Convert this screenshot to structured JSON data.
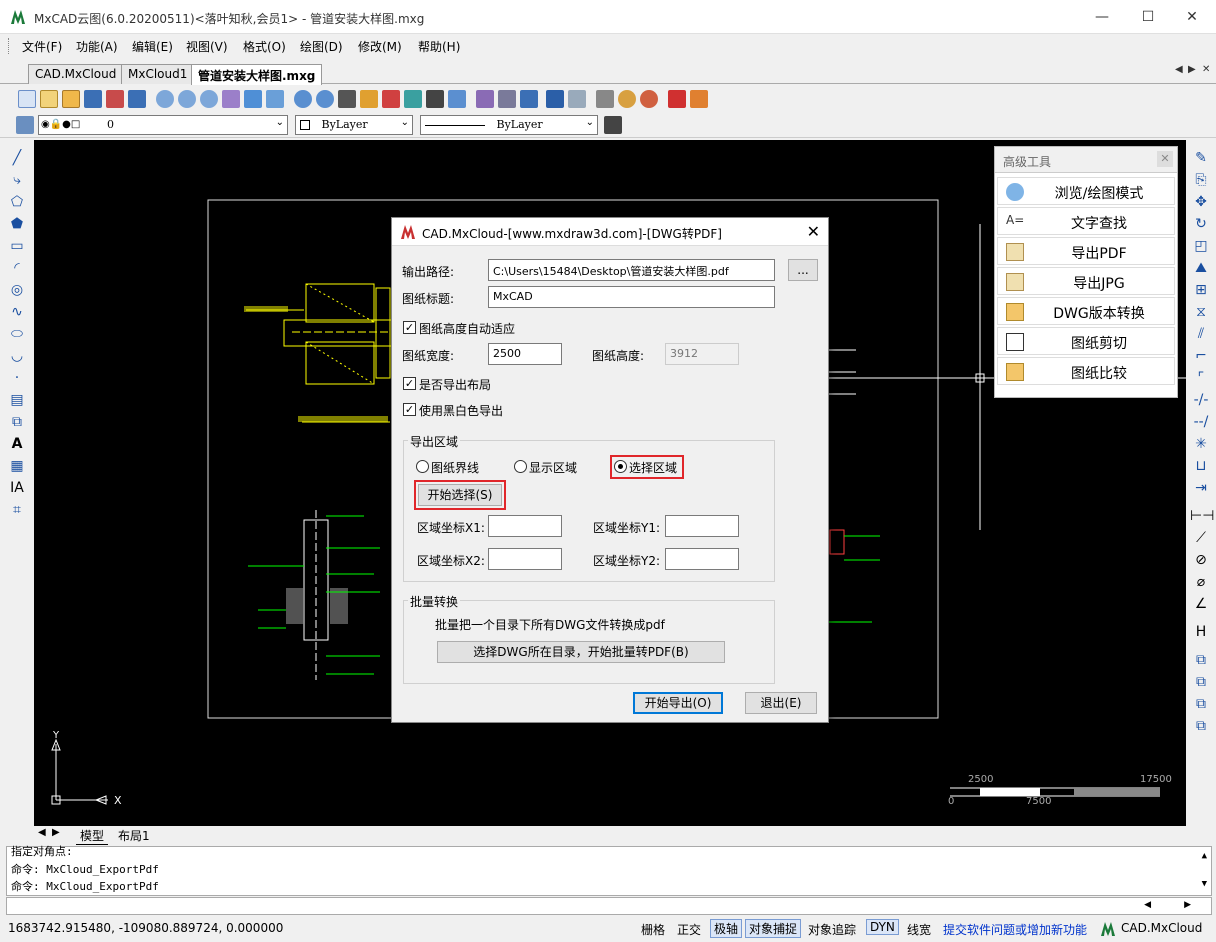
{
  "window": {
    "title": "MxCAD云图(6.0.20200511)<落叶知秋,会员1> - 管道安装大样图.mxg",
    "controls": [
      "—",
      "☐",
      "✕"
    ]
  },
  "menu": [
    "文件(F)",
    "功能(A)",
    "编辑(E)",
    "视图(V)",
    "格式(O)",
    "绘图(D)",
    "修改(M)",
    "帮助(H)"
  ],
  "doc_tabs": [
    "CAD.MxCloud",
    "MxCloud1",
    "管道安装大样图.mxg"
  ],
  "tab_nav": [
    "◀",
    "▶",
    "✕"
  ],
  "layer_bar": {
    "layer_value": "0",
    "color_value": "ByLayer",
    "linetype_value": "ByLayer"
  },
  "canvas": {
    "ucs_y": "Y",
    "ucs_x": "X",
    "scale_labels": [
      "2500",
      "17500",
      "0",
      "7500"
    ]
  },
  "layout_tabs": [
    "模型",
    "布局1"
  ],
  "command_lines": [
    "指定对角点:",
    "命令: MxCloud_ExportPdf",
    "命令: MxCloud_ExportPdf"
  ],
  "status": {
    "coords": "1683742.915480,  -109080.889724,  0.000000",
    "toggles": [
      "栅格",
      "正交",
      "极轴",
      "对象捕捉",
      "对象追踪",
      "DYN",
      "线宽"
    ],
    "feedback_link": "提交软件问题或增加新功能",
    "brand": "CAD.MxCloud"
  },
  "advanced_panel": {
    "title": "高级工具",
    "items": [
      {
        "label": "浏览/绘图模式",
        "icon": "browse-icon"
      },
      {
        "label": "文字查找",
        "icon": "text-find-icon"
      },
      {
        "label": "导出PDF",
        "icon": "pdf-icon"
      },
      {
        "label": "导出JPG",
        "icon": "jpg-icon"
      },
      {
        "label": "DWG版本转换",
        "icon": "convert-icon"
      },
      {
        "label": "图纸剪切",
        "icon": "cut-icon"
      },
      {
        "label": "图纸比较",
        "icon": "compare-icon"
      }
    ]
  },
  "dialog": {
    "title": "CAD.MxCloud-[www.mxdraw3d.com]-[DWG转PDF]",
    "output_path_label": "输出路径:",
    "output_path_value": "C:\\Users\\15484\\Desktop\\管道安装大样图.pdf",
    "browse_label": "...",
    "drawing_title_label": "图纸标题:",
    "drawing_title_value": "MxCAD",
    "auto_height_label": "图纸高度自动适应",
    "width_label": "图纸宽度:",
    "width_value": "2500",
    "height_label": "图纸高度:",
    "height_value": "3912",
    "export_layout_label": "是否导出布局",
    "bw_label": "使用黑白色导出",
    "region_group": "导出区域",
    "radio_border": "图纸界线",
    "radio_display": "显示区域",
    "radio_select": "选择区域",
    "start_select": "开始选择(S)",
    "x1_label": "区域坐标X1:",
    "y1_label": "区域坐标Y1:",
    "x2_label": "区域坐标X2:",
    "y2_label": "区域坐标Y2:",
    "batch_group": "批量转换",
    "batch_desc": "批量把一个目录下所有DWG文件转换成pdf",
    "batch_button": "选择DWG所在目录，开始批量转PDF(B)",
    "export_button": "开始导出(O)",
    "exit_button": "退出(E)"
  },
  "colors": {
    "canvas_bg": "#000000",
    "drawing_yellow": "#ffff00",
    "drawing_green": "#00ff00",
    "highlight_red": "#e0262a",
    "link_blue": "#0033cc"
  }
}
